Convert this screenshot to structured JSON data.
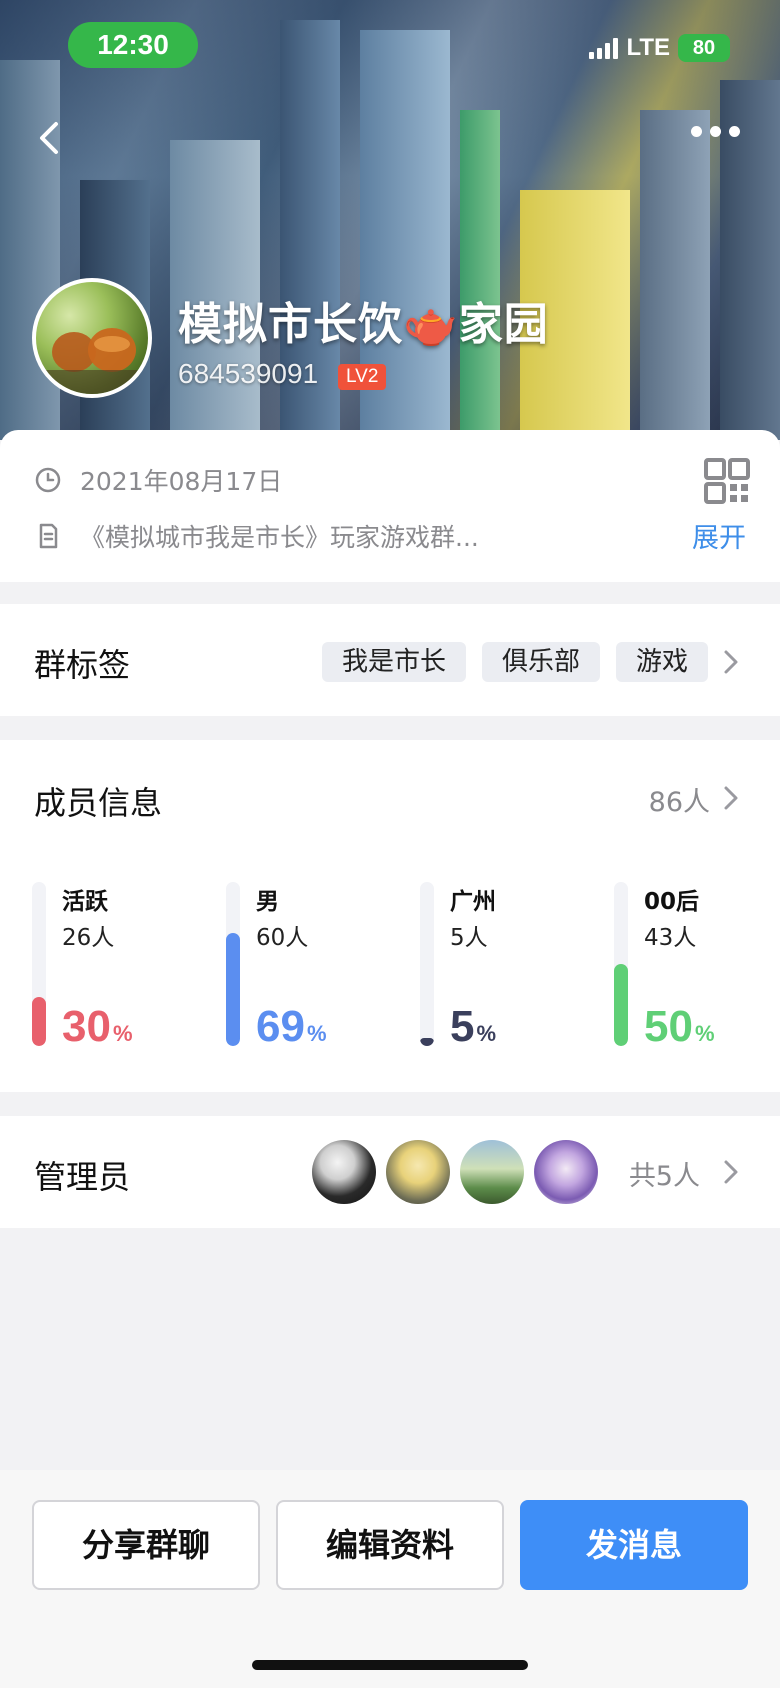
{
  "status_bar": {
    "time": "12:30",
    "network": "LTE",
    "battery": "80"
  },
  "header": {
    "group_name": "模拟市长饮🫖家园",
    "group_id": "684539091",
    "level": "LV2"
  },
  "info": {
    "created_date": "2021年08月17日",
    "description": "《模拟城市我是市长》玩家游戏群...",
    "expand_label": "展开"
  },
  "tags_section": {
    "title": "群标签",
    "tags": [
      "我是市长",
      "俱乐部",
      "游戏"
    ]
  },
  "members_section": {
    "title": "成员信息",
    "count": "86人",
    "stats": [
      {
        "label": "活跃",
        "count": "26人",
        "pct": "30",
        "unit": "%",
        "fraction": 0.3,
        "color": "#e8606c"
      },
      {
        "label": "男",
        "count": "60人",
        "pct": "69",
        "unit": "%",
        "fraction": 0.69,
        "color": "#5b8ef0"
      },
      {
        "label": "广州",
        "count": "5人",
        "pct": "5",
        "unit": "%",
        "fraction": 0.05,
        "color": "#3a3f5c"
      },
      {
        "label": "00后",
        "count": "43人",
        "pct": "50",
        "unit": "%",
        "fraction": 0.5,
        "color": "#5fcf76"
      }
    ]
  },
  "admins_section": {
    "title": "管理员",
    "count": "共5人"
  },
  "actions": {
    "share": "分享群聊",
    "edit": "编辑资料",
    "message": "发消息"
  },
  "colors": {
    "accent": "#3e8ef7",
    "link": "#3e8ee9",
    "level_badge": "#f0523a",
    "status_green": "#35b74a"
  }
}
